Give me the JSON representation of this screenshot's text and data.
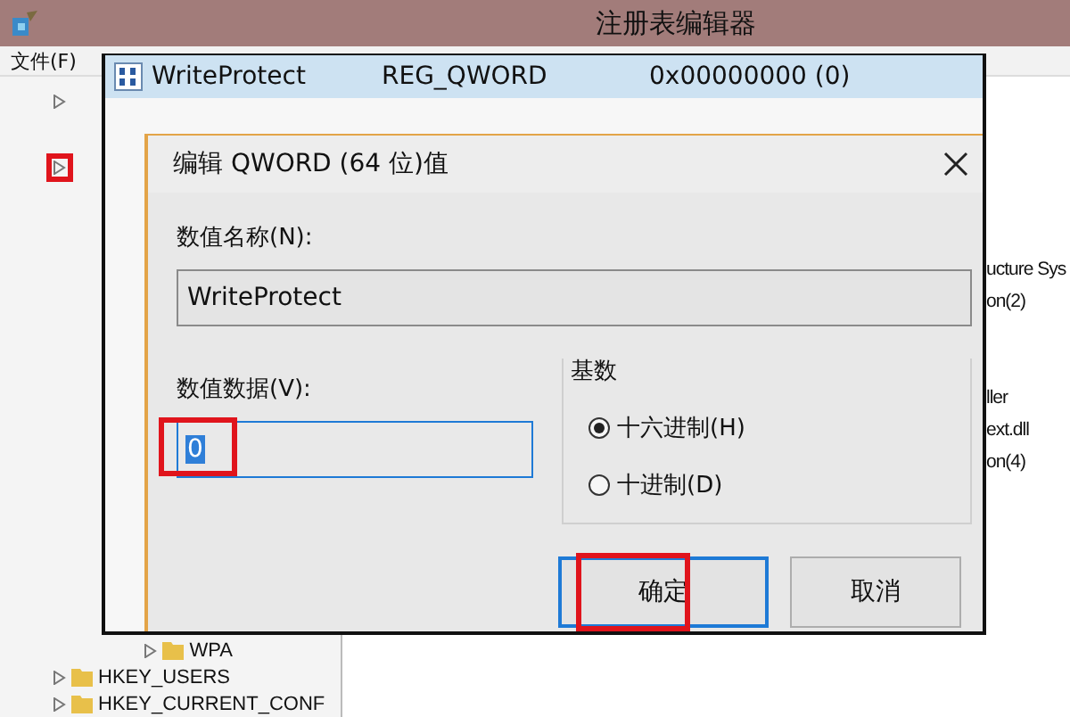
{
  "window": {
    "title": "注册表编辑器",
    "menu": [
      "文件(F)"
    ]
  },
  "tree": [
    {
      "expanded": false,
      "highlighted": false
    },
    {
      "expanded": false,
      "highlighted": true,
      "children": [
        {
          "label": "WPA",
          "expanded": false
        }
      ]
    },
    {
      "label": "HKEY_USERS",
      "expanded": false
    },
    {
      "label": "HKEY_CURRENT_CONF",
      "expanded": false
    }
  ],
  "details_fragments": [
    "ucture Sys",
    "on(2)",
    "ller",
    "ext.dll",
    "on(4)"
  ],
  "value_row": {
    "name": "WriteProtect",
    "type": "REG_QWORD",
    "data": "0x00000000 (0)",
    "selected": true
  },
  "dialog": {
    "title": "编辑 QWORD (64 位)值",
    "name_label": "数值名称(N):",
    "name_value": "WriteProtect",
    "data_label": "数值数据(V):",
    "data_value": "0",
    "data_highlighted": true,
    "base": {
      "title": "基数",
      "options": [
        {
          "label": "十六进制(H)",
          "selected": true
        },
        {
          "label": "十进制(D)",
          "selected": false
        }
      ]
    },
    "buttons": [
      {
        "label": "确定",
        "default": true,
        "highlighted": true
      },
      {
        "label": "取消",
        "default": false,
        "highlighted": false
      }
    ]
  }
}
